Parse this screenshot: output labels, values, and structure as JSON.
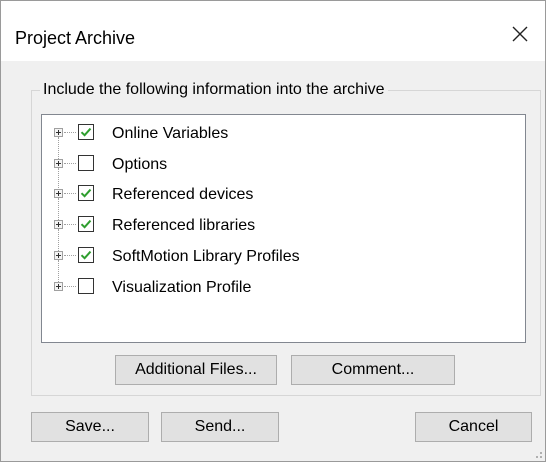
{
  "window": {
    "title": "Project Archive",
    "close_icon": "close-icon"
  },
  "group": {
    "legend": "Include the following information into the archive"
  },
  "tree": {
    "items": [
      {
        "label": "Online Variables",
        "checked": true
      },
      {
        "label": "Options",
        "checked": false
      },
      {
        "label": "Referenced devices",
        "checked": true
      },
      {
        "label": "Referenced libraries",
        "checked": true
      },
      {
        "label": "SoftMotion Library Profiles",
        "checked": true
      },
      {
        "label": "Visualization Profile",
        "checked": false
      }
    ]
  },
  "buttons": {
    "additional_files": "Additional Files...",
    "comment": "Comment...",
    "save": "Save...",
    "send": "Send...",
    "cancel": "Cancel"
  },
  "colors": {
    "dialog_bg": "#f0f0f0",
    "check_green": "#2e9e2e",
    "border": "#828790"
  }
}
